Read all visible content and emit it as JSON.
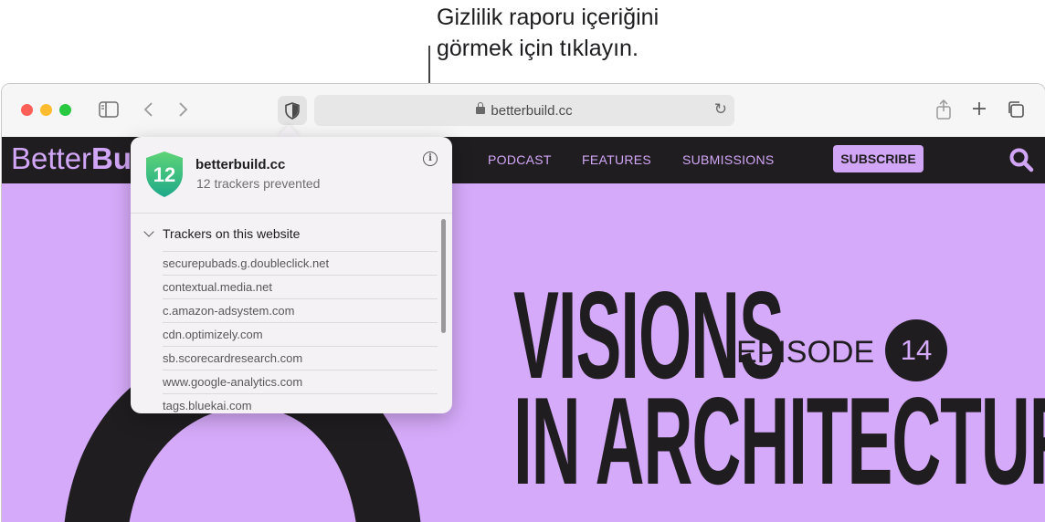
{
  "callout": {
    "line1": "Gizlilik raporu içeriğini",
    "line2": "görmek için tıklayın."
  },
  "browser": {
    "url": "betterbuild.cc",
    "colors": {
      "close": "#ff5f57",
      "minimize": "#febc2e",
      "zoom": "#28c840"
    },
    "icons": [
      "sidebar-icon",
      "back-icon",
      "forward-icon",
      "privacy-shield-icon",
      "lock-icon",
      "reload-icon",
      "share-icon",
      "new-tab-icon",
      "tab-overview-icon"
    ]
  },
  "site": {
    "logo_regular": "Better",
    "logo_bold": "Bu",
    "nav": [
      "PODCAST",
      "FEATURES",
      "SUBMISSIONS"
    ],
    "subscribe": "SUBSCRIBE",
    "hero_line1": "VISIONS",
    "hero_line2": "IN ARCHITECTURE",
    "episode_label": "EPISODE",
    "episode_number": "14",
    "colors": {
      "accent": "#d2a6f7",
      "hero_bg": "#d6aafa",
      "dark": "#1f1d20"
    }
  },
  "privacy_report": {
    "badge_count": "12",
    "domain": "betterbuild.cc",
    "subtitle": "12 trackers prevented",
    "section_title": "Trackers on this website",
    "trackers": [
      "securepubads.g.doubleclick.net",
      "contextual.media.net",
      "c.amazon-adsystem.com",
      "cdn.optimizely.com",
      "sb.scorecardresearch.com",
      "www.google-analytics.com",
      "tags.bluekai.com"
    ]
  }
}
